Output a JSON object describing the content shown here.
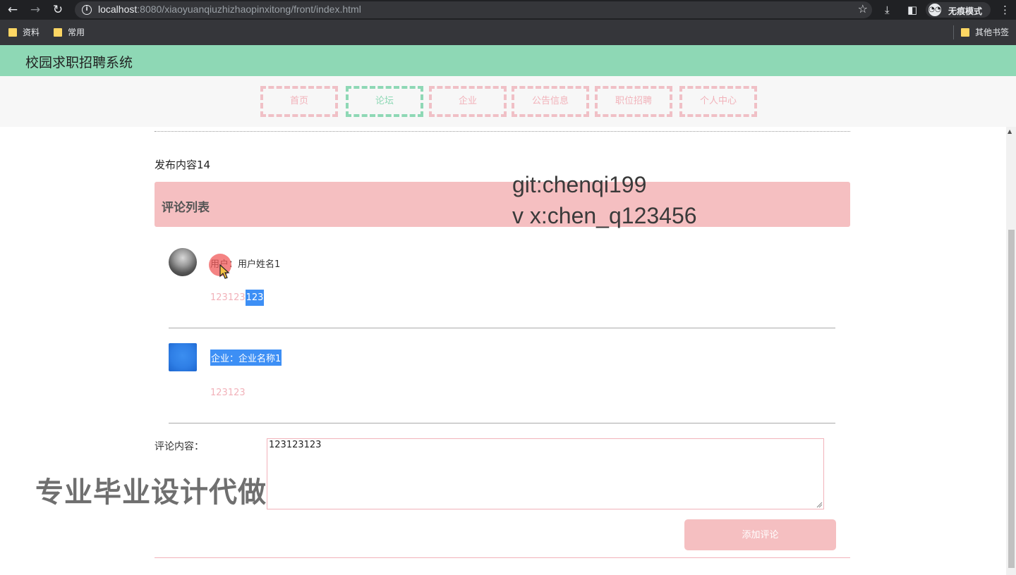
{
  "browser": {
    "url_host": "localhost",
    "url_rest": ":8080/xiaoyuanqiuzhizhaopinxitong/front/index.html",
    "incognito_label": "无痕模式",
    "bookmarks": [
      "资料",
      "常用"
    ],
    "other_bookmarks": "其他书签"
  },
  "site": {
    "title": "校园求职招聘系统",
    "nav": [
      "首页",
      "论坛",
      "企业",
      "公告信息",
      "职位招聘",
      "个人中心"
    ],
    "active_nav": "论坛"
  },
  "post": {
    "content": "发布内容14"
  },
  "comments_section": {
    "title": "评论列表",
    "comments": [
      {
        "author_prefix": "用户：",
        "author_name": "用户姓名1",
        "text_plain": "123123",
        "text_selected": "123"
      },
      {
        "author": "企业：企业名称1",
        "text": "123123"
      }
    ]
  },
  "form": {
    "label": "评论内容：",
    "value": "123123123",
    "submit_label": "添加评论"
  },
  "overlays": {
    "git": "git:chenqi199",
    "wx": "v x:chen_q123456",
    "ad": "专业毕业设计代做"
  },
  "colors": {
    "header_green": "#8ed8b5",
    "accent_pink": "#f5bfc1",
    "selection_blue": "#3d8ff5"
  },
  "icons": [
    "back-arrow-icon",
    "forward-arrow-icon",
    "reload-icon",
    "info-icon",
    "star-icon",
    "download-icon",
    "sidepanel-icon",
    "incognito-icon",
    "kebab-menu-icon",
    "folder-icon",
    "cursor-icon"
  ]
}
